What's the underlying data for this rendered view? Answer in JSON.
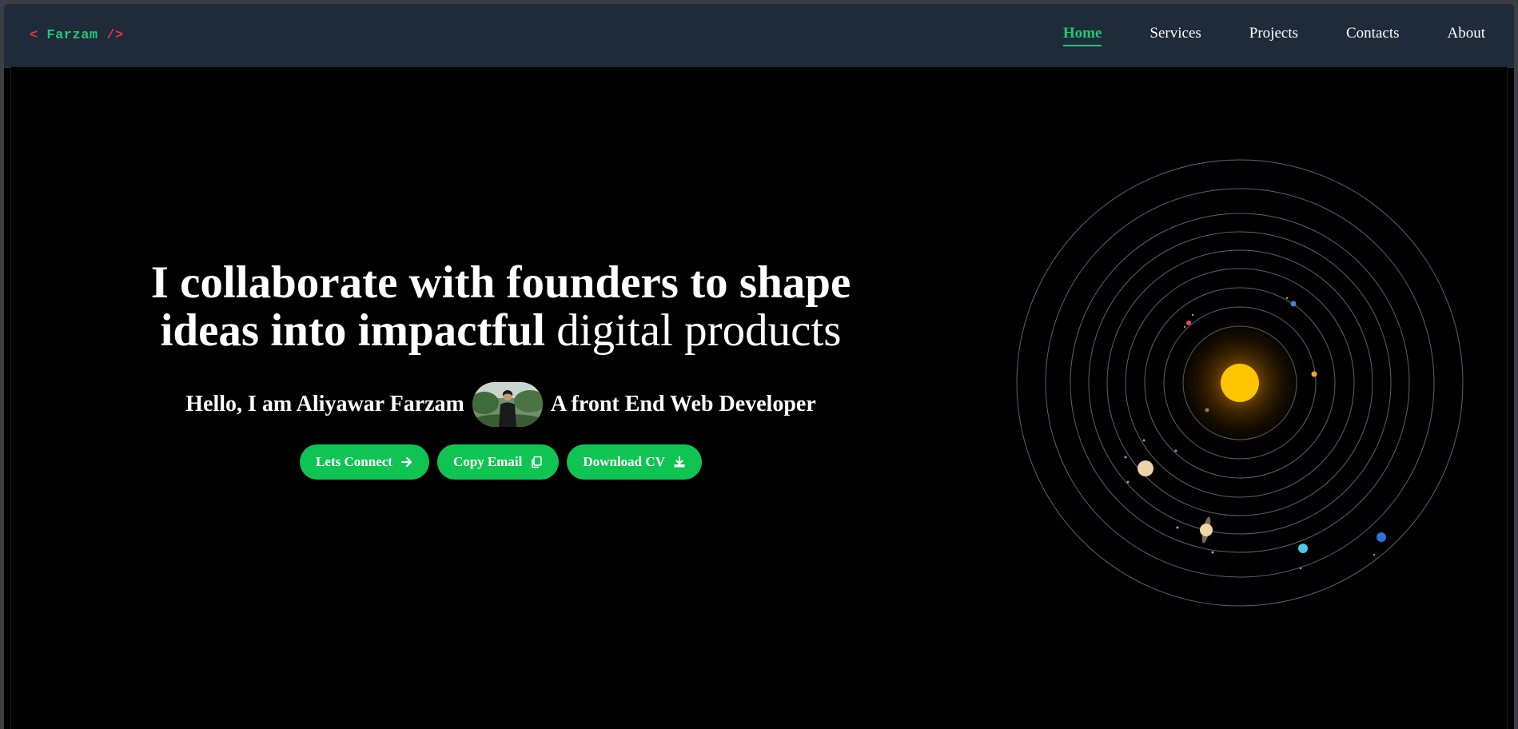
{
  "logo": {
    "open": "<",
    "name": "Farzam",
    "close": "/>"
  },
  "nav": {
    "items": [
      {
        "label": "Home"
      },
      {
        "label": "Services"
      },
      {
        "label": "Projects"
      },
      {
        "label": "Contacts"
      },
      {
        "label": "About"
      }
    ]
  },
  "hero": {
    "headline_bold_1": "I collaborate with founders to shape",
    "headline_bold_2": "ideas into impactful",
    "headline_light": "digital products",
    "intro_left": "Hello, I am Aliyawar Farzam",
    "intro_right": "A front End Web Developer"
  },
  "buttons": {
    "connect": "Lets Connect",
    "copy_email": "Copy Email",
    "download_cv": "Download CV"
  },
  "colors": {
    "accent": "#10c454",
    "nav_bg": "#1f2a3a",
    "logo_bracket": "#e0373b",
    "sun": "#ffc400"
  }
}
